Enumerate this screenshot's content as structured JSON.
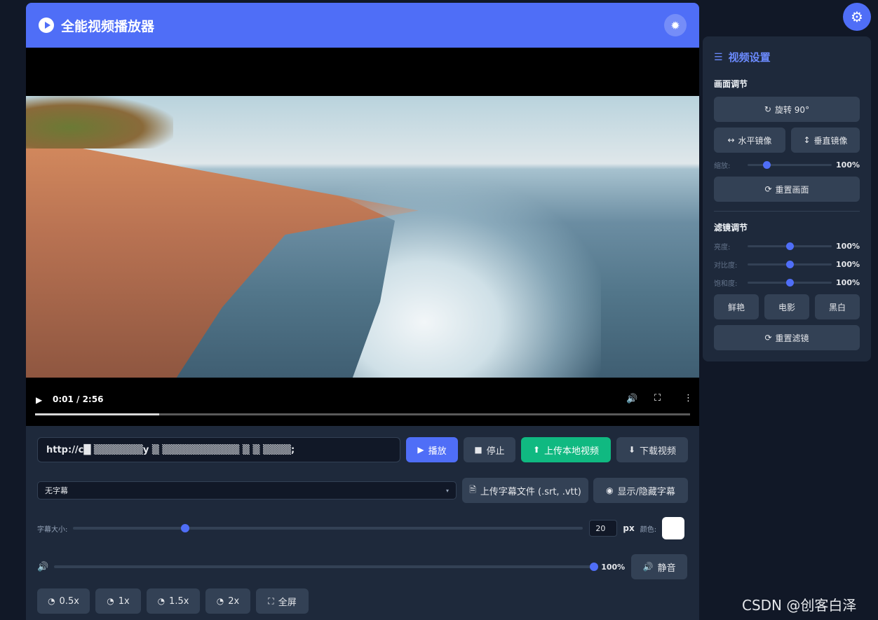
{
  "app": {
    "title": "全能视频播放器"
  },
  "video": {
    "time": "0:01 / 2:56",
    "progress": 0.19
  },
  "url_input": {
    "value": "http://c█ ▒▒▒▒▒▒▒y   ▒   ▒▒▒▒▒▒▒▒▒▒▒ ▒ ▒ ▒▒▒▒;"
  },
  "controls": {
    "play": "播放",
    "stop": "停止",
    "upload_local": "上传本地视频",
    "download": "下载视频"
  },
  "subtitle": {
    "selected": "无字幕",
    "upload": "上传字幕文件 (.srt, .vtt)",
    "toggle": "显示/隐藏字幕",
    "size_label": "字幕大小:",
    "size_value": "20",
    "size_unit": "px",
    "size_fraction": 0.22,
    "color_label": "颜色:",
    "color": "#ffffff"
  },
  "volume": {
    "value": "100%",
    "fraction": 1.0,
    "mute": "静音"
  },
  "speed": {
    "buttons": [
      "0.5x",
      "1x",
      "1.5x",
      "2x"
    ],
    "fullscreen": "全屏"
  },
  "panel": {
    "title": "视频设置",
    "picture_section": "画面调节",
    "rotate": "旋转 90°",
    "flip_h": "水平镜像",
    "flip_v": "垂直镜像",
    "zoom_label": "缩放:",
    "zoom_value": "100%",
    "zoom_fraction": 0.23,
    "reset_picture": "重置画面",
    "filter_section": "滤镜调节",
    "brightness_label": "亮度:",
    "brightness_value": "100%",
    "contrast_label": "对比度:",
    "contrast_value": "100%",
    "saturation_label": "饱和度:",
    "saturation_value": "100%",
    "filter_fraction": 0.5,
    "presets": [
      "鲜艳",
      "电影",
      "黑白"
    ],
    "reset_filter": "重置滤镜"
  },
  "watermark": "CSDN @创客白泽",
  "colors": {
    "accent": "#4f6ef7",
    "success": "#10b981",
    "surface": "#1e293b",
    "background": "#111827"
  }
}
